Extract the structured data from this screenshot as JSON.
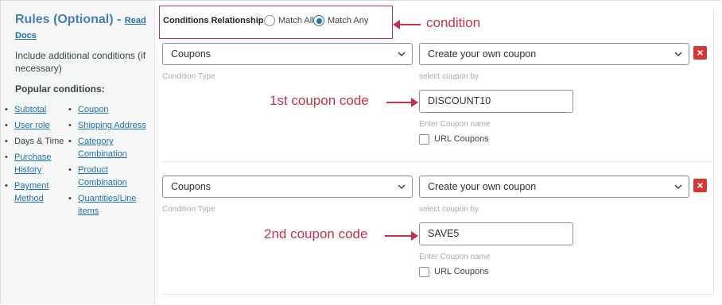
{
  "left_panel": {
    "title": "Rules (Optional) -",
    "read_docs": "Read Docs",
    "description": "Include additional conditions (if necessary)",
    "popular_heading": "Popular conditions:",
    "popular_left": [
      "Subtotal",
      "User role",
      "Days & Time",
      "Purchase History",
      "Payment Method"
    ],
    "popular_right": [
      "Coupon",
      "Shipping Address",
      "Category Combination",
      "Product Combination",
      "Quantities/Line items"
    ]
  },
  "conditions_relationship": {
    "label": "Conditions Relationship",
    "options": [
      "Match All",
      "Match Any"
    ],
    "selected": "Match Any"
  },
  "annotations": {
    "condition": "condition",
    "first_coupon": "1st coupon code",
    "second_coupon": "2nd coupon code"
  },
  "rules": [
    {
      "condition_type_value": "Coupons",
      "condition_type_hint": "Condition Type",
      "coupon_by_value": "Create your own coupon",
      "coupon_by_hint": "select coupon by",
      "coupon_name_value": "DISCOUNT10",
      "coupon_name_hint": "Enter Coupon name",
      "url_coupons_label": "URL Coupons",
      "delete_label": "×"
    },
    {
      "condition_type_value": "Coupons",
      "condition_type_hint": "Condition Type",
      "coupon_by_value": "Create your own coupon",
      "coupon_by_hint": "select coupon by",
      "coupon_name_value": "SAVE5",
      "coupon_name_hint": "Enter Coupon name",
      "url_coupons_label": "URL Coupons",
      "delete_label": "×"
    }
  ],
  "colors": {
    "accent": "#2271b1",
    "annotation": "#c4314b",
    "delete": "#d63638"
  }
}
